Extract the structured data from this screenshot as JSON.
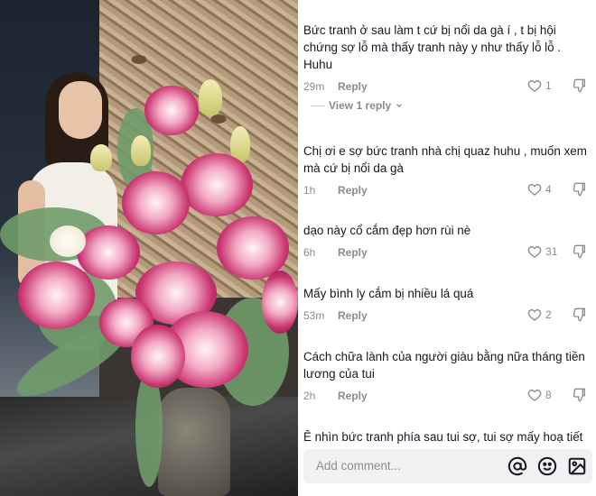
{
  "comments": [
    {
      "text": "Bức tranh ở sau làm t cứ bị nổi da gà í , t bị hội chứng sợ lỗ mà thấy tranh này y như thấy lỗ lỗ . Huhu",
      "time": "29m",
      "reply": "Reply",
      "likes": "1"
    },
    {
      "text": "Chị ơi e sợ bức tranh nhà chị quaz huhu , muốn xem mà cứ bị nổi da gà",
      "time": "1h",
      "reply": "Reply",
      "likes": "4"
    },
    {
      "text": "dạo này cổ cắm đẹp hơn rùi nè",
      "time": "6h",
      "reply": "Reply",
      "likes": "31"
    },
    {
      "text": "Mấy bình ly cắm bị nhiều lá quá",
      "time": "53m",
      "reply": "Reply",
      "likes": "2"
    },
    {
      "text": "Cách chữa lành của người giàu bằng nữa tháng tiền lương của tui",
      "time": "2h",
      "reply": "Reply",
      "likes": "8"
    },
    {
      "text": "Ê nhìn bức tranh phía sau tui sợ, tui sợ mấy hoạ tiết"
    }
  ],
  "view_replies": "View 1 reply",
  "input": {
    "placeholder": "Add comment..."
  },
  "icons": {
    "like": "heart-outline-icon",
    "dislike": "thumbs-down-icon",
    "mention": "at-sign-icon",
    "emoji": "smiley-icon",
    "image": "image-icon"
  },
  "colors": {
    "text": "#161823",
    "muted": "#8a8b91",
    "input_bg": "#f1f1f2"
  }
}
